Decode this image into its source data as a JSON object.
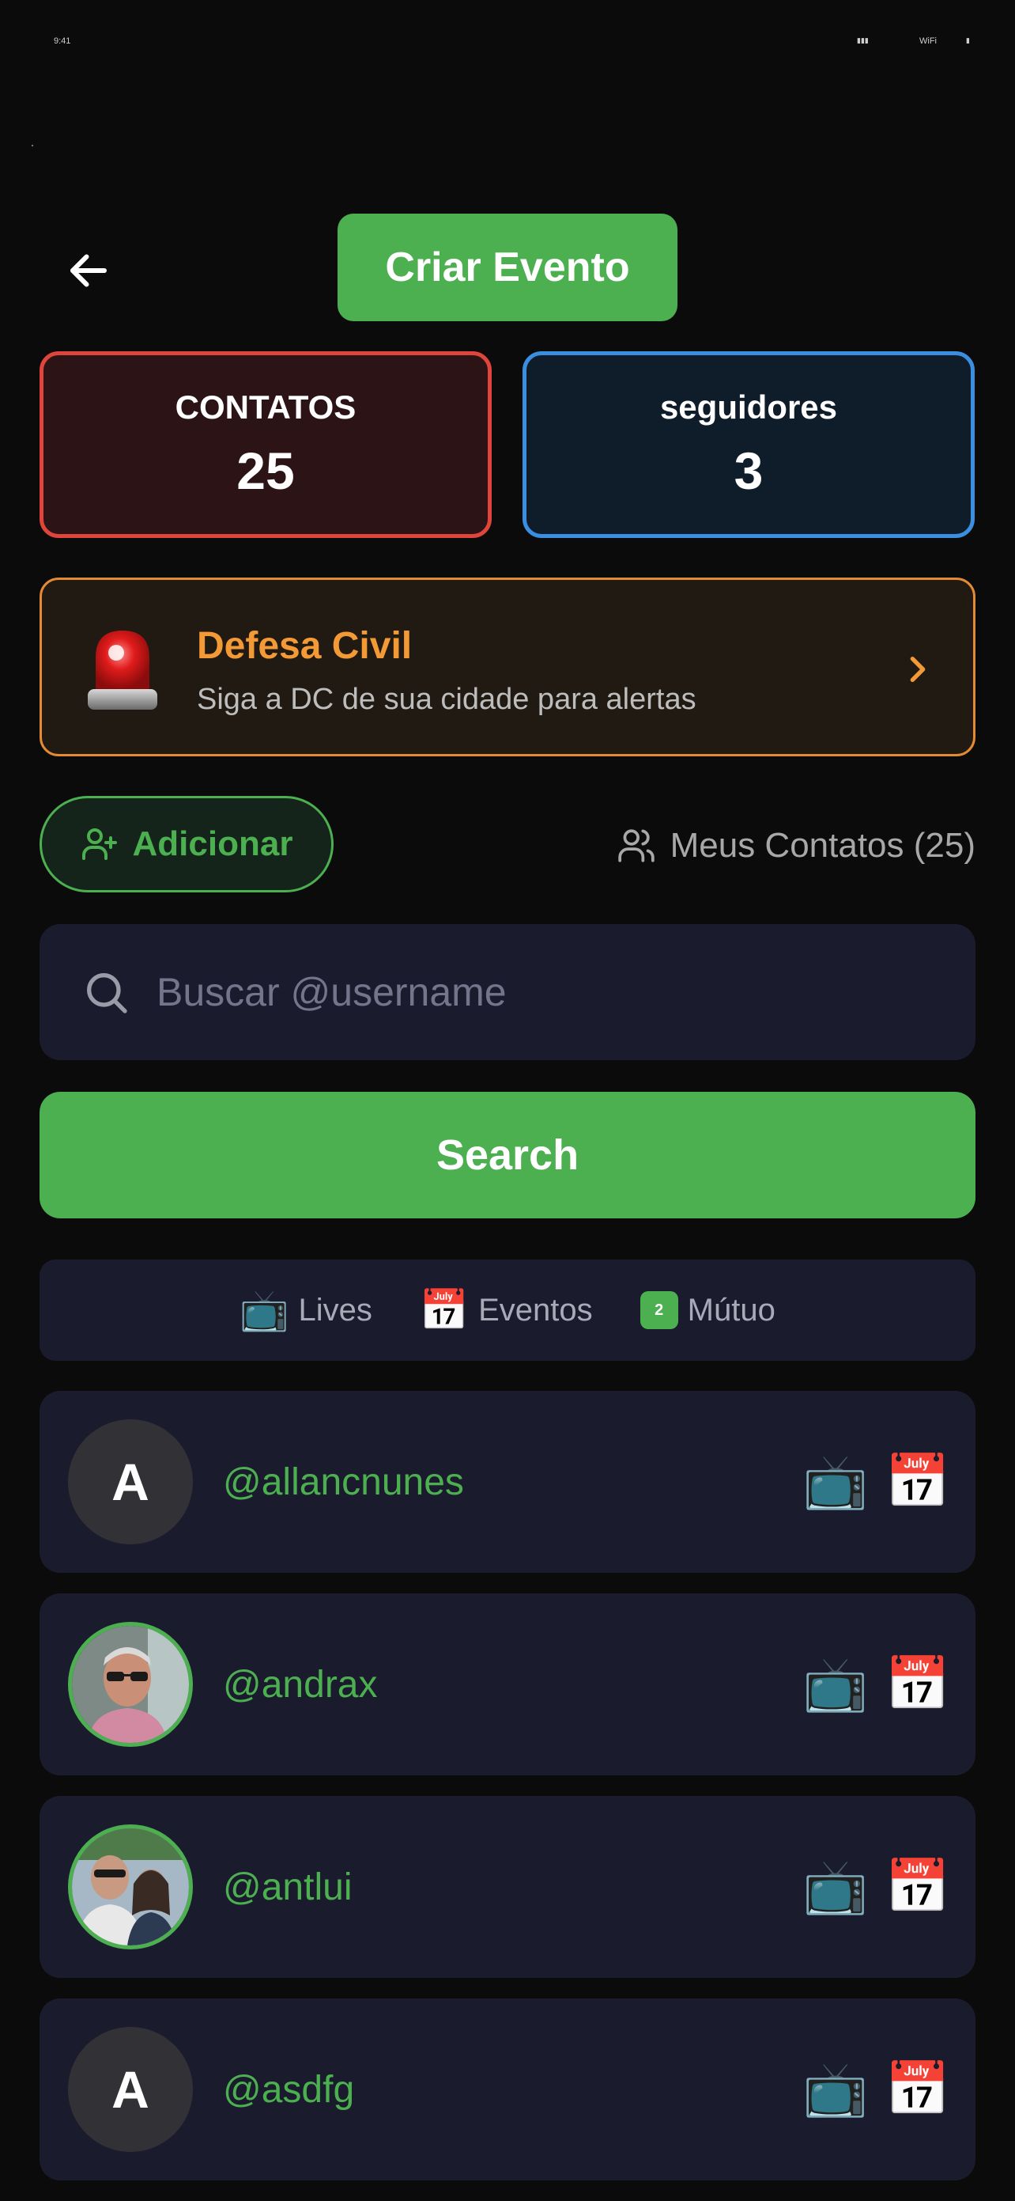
{
  "status_bar": {
    "time": "9:41",
    "battery": "▮▮▮",
    "wifi": "WiFi",
    "signal": "▮"
  },
  "header": {
    "create_event_label": "Criar Evento"
  },
  "stats": {
    "contacts": {
      "label": "CONTATOS",
      "value": "25"
    },
    "followers": {
      "label": "seguidores",
      "value": "3"
    }
  },
  "defesa_civil": {
    "title": "Defesa Civil",
    "subtitle": "Siga a DC de sua cidade para alertas"
  },
  "actions": {
    "add_label": "Adicionar",
    "my_contacts_label": "Meus Contatos (25)"
  },
  "search": {
    "placeholder": "Buscar @username",
    "value": "",
    "button_label": "Search"
  },
  "legend": {
    "lives": {
      "emoji": "📺",
      "label": "Lives"
    },
    "events": {
      "emoji": "📅",
      "label": "Eventos"
    },
    "mutual": {
      "badge": "2",
      "label": "Mútuo"
    }
  },
  "contacts": [
    {
      "username": "@allancnunes",
      "initial": "A",
      "has_photo": false,
      "icons": [
        "📺",
        "📅"
      ]
    },
    {
      "username": "@andrax",
      "initial": "",
      "has_photo": true,
      "icons": [
        "📺",
        "📅"
      ]
    },
    {
      "username": "@antlui",
      "initial": "",
      "has_photo": true,
      "icons": [
        "📺",
        "📅"
      ]
    },
    {
      "username": "@asdfg",
      "initial": "A",
      "has_photo": false,
      "icons": [
        "📺",
        "📅"
      ]
    }
  ],
  "colors": {
    "accent_green": "#4caf50",
    "contacts_red": "#e0453c",
    "followers_blue": "#3a8fe0",
    "dc_orange": "#f39a36"
  },
  "icons": {
    "back": "arrow-left-icon",
    "siren": "siren-icon",
    "chevron": "chevron-right-icon",
    "add_user": "user-plus-icon",
    "users": "users-icon",
    "search": "search-icon"
  }
}
